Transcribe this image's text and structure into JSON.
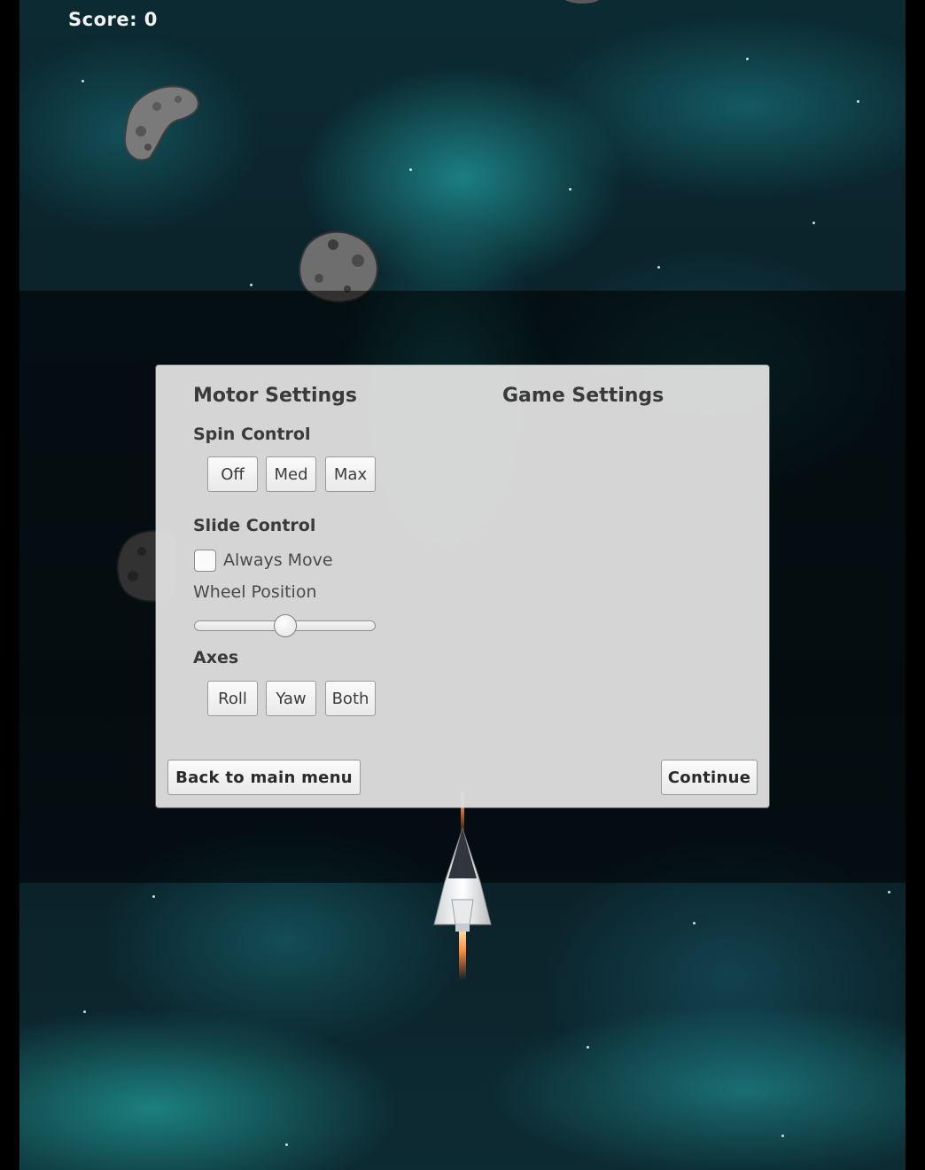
{
  "hud": {
    "score_text": "Score: 0"
  },
  "settings_panel": {
    "motor_title": "Motor Settings",
    "game_title": "Game Settings",
    "spin_control": {
      "label": "Spin Control",
      "options": [
        "Off",
        "Med",
        "Max"
      ]
    },
    "slide_control": {
      "label": "Slide Control",
      "always_move_label": "Always Move",
      "always_move_checked": false,
      "wheel_position_label": "Wheel Position",
      "wheel_position_value": 0.5
    },
    "axes": {
      "label": "Axes",
      "options": [
        "Roll",
        "Yaw",
        "Both"
      ]
    },
    "back_button": "Back to main menu",
    "continue_button": "Continue"
  },
  "colors": {
    "panel_bg": "#dedede",
    "text": "#3a3a3a",
    "space_teal": "#1fb3b3"
  },
  "icons": [
    "asteroid",
    "asteroid",
    "asteroid",
    "asteroid",
    "spaceship"
  ]
}
